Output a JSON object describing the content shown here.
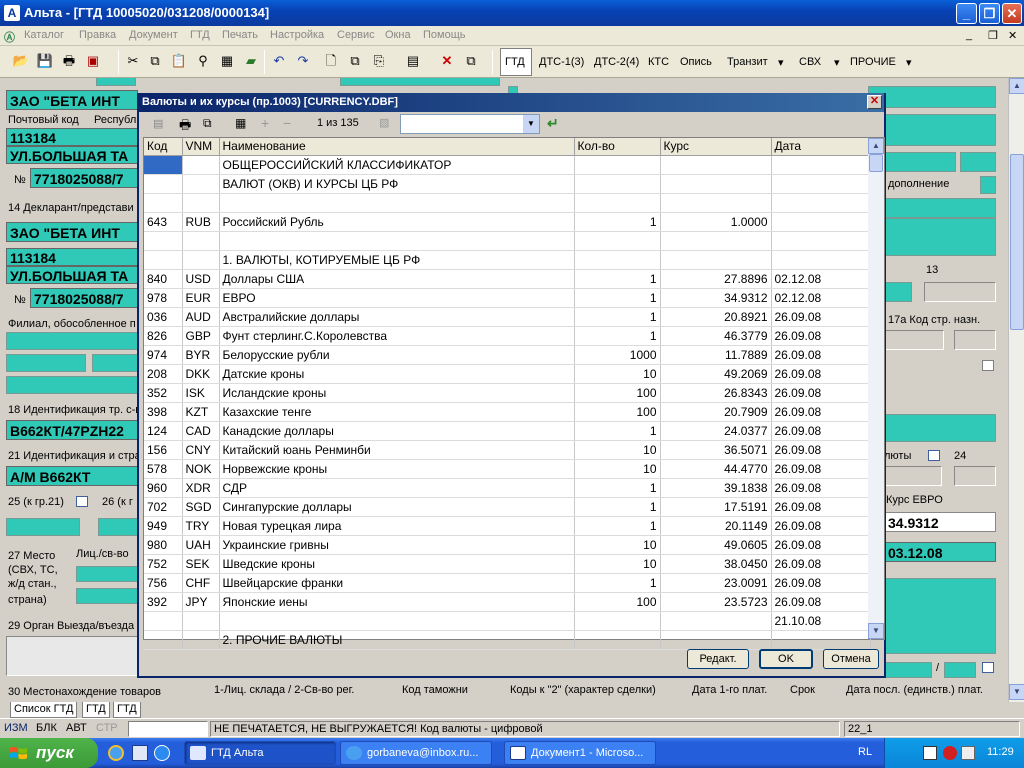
{
  "window": {
    "title": "Альта - [ГТД 10005020/031208/0000134]",
    "app_icon": "А"
  },
  "menu": [
    "Каталог",
    "Правка",
    "Документ",
    "ГТД",
    "Печать",
    "Настройка",
    "Сервис",
    "Окна",
    "Помощь"
  ],
  "toolbar": {
    "tabs": [
      "ГТД",
      "ДТС-1(3)",
      "ДТС-2(4)",
      "КТС",
      "Опись",
      "Транзит",
      "СВХ",
      "ПРОЧИЕ"
    ]
  },
  "form": {
    "company1": "ЗАО \"БЕТА ИНТ",
    "postal_label": "Почтовый код",
    "republic_label": "Республ",
    "postcode1": "113184",
    "street1": "УЛ.БОЛЬШАЯ ТА",
    "no_label": "№",
    "inn1": "7718025088/7",
    "declarant_label": "14 Декларант/представи",
    "company2": "ЗАО \"БЕТА ИНТ",
    "postcode2": "113184",
    "street2": "УЛ.БОЛЬШАЯ ТА",
    "inn2": "7718025088/7",
    "branch_label": "Филиал, обособленное п",
    "ident18_label": "18 Идентификация тр. с-в",
    "vehicle": "В662КТ/47PZH22",
    "ident21_label": "21 Идентификация и стра",
    "vehicle2": "А/М В662КТ",
    "box25": "25 (к гр.21)",
    "box26": "26 (к г",
    "place27": "27  Место",
    "place27b": "(СВХ, ТС,",
    "place27c": "ж/д стан.,",
    "place27d": "страна)",
    "lic_label": "Лиц./св-во",
    "org29": "29 Орган Выезда/въезда",
    "loc30": "30 Местонахождение товаров",
    "loc30b": "1-Лиц. склада / 2-Св-во рег.",
    "customs_code": "Код таможни",
    "right_addition": "дополнение",
    "right_13": "13",
    "right_17a": "17а Код стр. назн.",
    "right_valuty": "люты",
    "right_24": "24",
    "kurs_label": "Курс ЕВРО",
    "kurs_value": "34.9312",
    "date_value": "03.12.08",
    "bottom_codes": "Коды к \"2\" (характер сделки)",
    "bottom_date1": "Дата 1-го плат.",
    "bottom_term": "Срок",
    "bottom_lastdate": "Дата посл. (единств.) плат.",
    "slash": "/"
  },
  "bottom_tabs": [
    "Список ГТД",
    "ГТД",
    "ГТД"
  ],
  "status": {
    "izm": "ИЗМ",
    "blk": "БЛК",
    "avt": "АВТ",
    "str": "СТР",
    "message": "НЕ ПЕЧАТАЕТСЯ, НЕ ВЫГРУЖАЕТСЯ! Код валюты - цифровой",
    "field": "22_1"
  },
  "taskbar": {
    "start": "пуск",
    "tasks": [
      "ГТД Альта",
      "gorbaneva@inbox.ru...",
      "Документ1 - Microso..."
    ],
    "lang": "RL",
    "clock": "11:29"
  },
  "dialog": {
    "title": "Валюты и их курсы (пр.1003)  [CURRENCY.DBF]",
    "counter": "1 из 135",
    "headers": [
      "Код",
      "VNM",
      "Наименование",
      "Кол-во",
      "Курс",
      "Дата"
    ],
    "rows": [
      [
        "",
        "",
        "ОБЩЕРОССИЙСКИЙ КЛАССИФИКАТОР",
        "",
        "",
        ""
      ],
      [
        "",
        "",
        "ВАЛЮТ (ОКВ) И КУРСЫ ЦБ РФ",
        "",
        "",
        ""
      ],
      [
        "",
        "",
        "",
        "",
        "",
        ""
      ],
      [
        "643",
        "RUB",
        "Российский Рубль",
        "1",
        "1.0000",
        ""
      ],
      [
        "",
        "",
        "",
        "",
        "",
        ""
      ],
      [
        "",
        "",
        "1. ВАЛЮТЫ, КОТИРУЕМЫЕ ЦБ РФ",
        "",
        "",
        ""
      ],
      [
        "840",
        "USD",
        "Доллары США",
        "1",
        "27.8896",
        "02.12.08"
      ],
      [
        "978",
        "EUR",
        "ЕВРО",
        "1",
        "34.9312",
        "02.12.08"
      ],
      [
        "036",
        "AUD",
        "Австралийские доллары",
        "1",
        "20.8921",
        "26.09.08"
      ],
      [
        "826",
        "GBP",
        "Фунт стерлинг.С.Королевства",
        "1",
        "46.3779",
        "26.09.08"
      ],
      [
        "974",
        "BYR",
        "Белорусские рубли",
        "1000",
        "11.7889",
        "26.09.08"
      ],
      [
        "208",
        "DKK",
        "Датские кроны",
        "10",
        "49.2069",
        "26.09.08"
      ],
      [
        "352",
        "ISK",
        "Исландские кроны",
        "100",
        "26.8343",
        "26.09.08"
      ],
      [
        "398",
        "KZT",
        "Казахские тенге",
        "100",
        "20.7909",
        "26.09.08"
      ],
      [
        "124",
        "CAD",
        "Канадские доллары",
        "1",
        "24.0377",
        "26.09.08"
      ],
      [
        "156",
        "CNY",
        "Китайский юань Ренминби",
        "10",
        "36.5071",
        "26.09.08"
      ],
      [
        "578",
        "NOK",
        "Норвежские кроны",
        "10",
        "44.4770",
        "26.09.08"
      ],
      [
        "960",
        "XDR",
        "СДР",
        "1",
        "39.1838",
        "26.09.08"
      ],
      [
        "702",
        "SGD",
        "Сингапурские доллары",
        "1",
        "17.5191",
        "26.09.08"
      ],
      [
        "949",
        "TRY",
        "Новая турецкая лира",
        "1",
        "20.1149",
        "26.09.08"
      ],
      [
        "980",
        "UAH",
        "Украинские гривны",
        "10",
        "49.0605",
        "26.09.08"
      ],
      [
        "752",
        "SEK",
        "Шведские кроны",
        "10",
        "38.0450",
        "26.09.08"
      ],
      [
        "756",
        "CHF",
        "Швейцарские франки",
        "1",
        "23.0091",
        "26.09.08"
      ],
      [
        "392",
        "JPY",
        "Японские иены",
        "100",
        "23.5723",
        "26.09.08"
      ],
      [
        "",
        "",
        "",
        "",
        "",
        "21.10.08"
      ],
      [
        "",
        "",
        "2. ПРОЧИЕ ВАЛЮТЫ",
        "",
        "",
        ""
      ]
    ],
    "buttons": {
      "edit": "Редакт.",
      "ok": "OK",
      "cancel": "Отмена"
    }
  },
  "colors": {
    "teal": "#30c8b6",
    "selected": "#316ac5",
    "title_blue": "#0a246a"
  }
}
